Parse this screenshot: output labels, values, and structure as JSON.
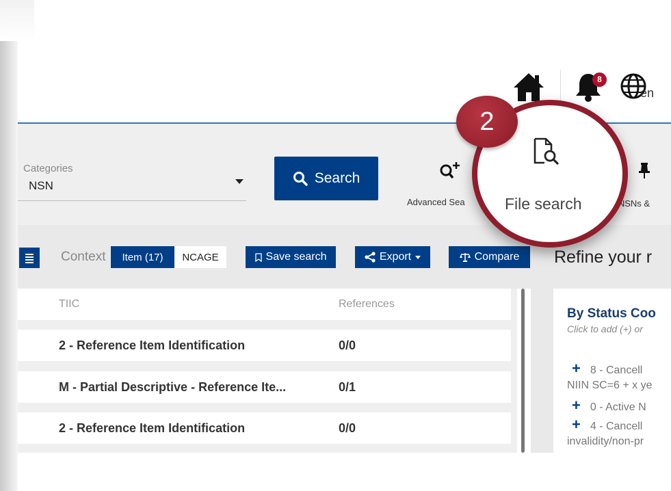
{
  "header": {
    "home_icon": "home-icon",
    "bell_icon": "bell-icon",
    "notification_count": "8",
    "globe_icon": "globe-icon",
    "language": "en"
  },
  "search": {
    "categories_label": "Categories",
    "categories_value": "NSN",
    "search_button_label": "Search",
    "advanced_search_label": "Advanced Sea",
    "file_search_label": "File search",
    "pinned_nsns_label": "d NSNs &"
  },
  "toolbar": {
    "context_label": "Context",
    "context_item_label": "Item (17)",
    "context_ncage_label": "NCAGE",
    "save_search_label": "Save search",
    "export_label": "Export",
    "compare_label": "Compare",
    "refine_title": "Refine your r"
  },
  "table": {
    "headers": {
      "tiic": "TIIC",
      "references": "References"
    },
    "rows": [
      {
        "tiic": "2 - Reference Item Identification",
        "references": "0/0"
      },
      {
        "tiic": "M - Partial Descriptive - Reference Ite...",
        "references": "0/1"
      },
      {
        "tiic": "2 - Reference Item Identification",
        "references": "0/0"
      }
    ]
  },
  "status_panel": {
    "title": "By Status Coo",
    "subtitle": "Click to add (+) or",
    "items": [
      {
        "text": "8 - Cancell",
        "continuation": "NIIN SC=6 + x ye"
      },
      {
        "text": "0 - Active N"
      },
      {
        "text": "4 - Cancell",
        "continuation": "invalidity/non-pr"
      }
    ]
  },
  "annotation": {
    "step_number": "2"
  },
  "colors": {
    "primary": "#003f87",
    "accent_line": "#2f74c0",
    "highlight": "#8f1d2c",
    "badge": "#b0102a"
  }
}
